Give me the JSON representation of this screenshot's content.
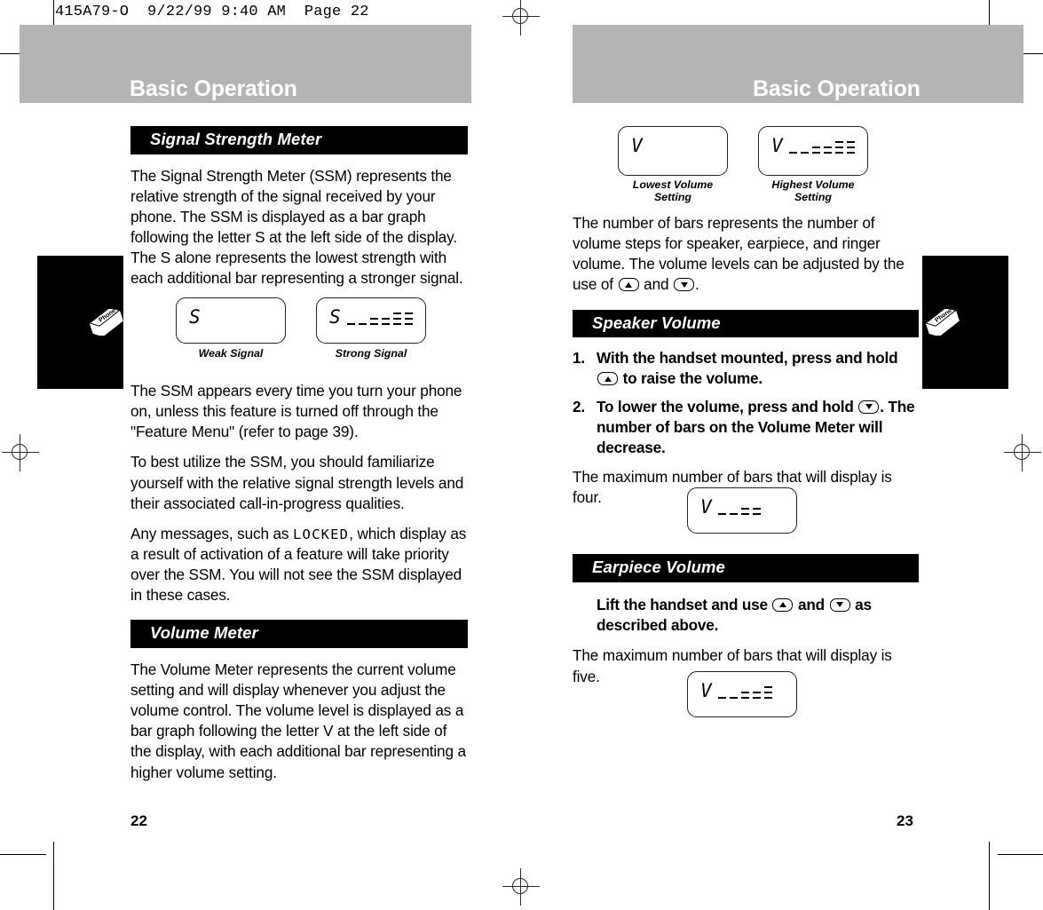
{
  "scan": {
    "header_line": "415A79-O  9/22/99 9:40 AM  Page 22"
  },
  "colors": {
    "banner_gray": "#b4b4b4",
    "section_head_bg": "#000000",
    "section_head_text": "#ffffff",
    "body_text": "#000000",
    "tab_black": "#000000"
  },
  "left_page": {
    "banner_title": "Basic Operation",
    "page_number": "22",
    "thumb_tab_icon": "phone-book-tab-icon",
    "sections": [
      {
        "heading": "Signal Strength Meter",
        "paragraphs": [
          "The Signal Strength Meter (SSM) represents the relative strength of the signal received by your phone. The SSM is displayed as a bar graph following the letter S at the left side of the display. The S alone represents the lowest strength with each additional bar representing a stronger signal."
        ]
      },
      {
        "heading": "Volume Meter",
        "paragraphs": [
          "The Volume Meter represents the current volume setting and will display whenever you adjust the volume control. The volume level is displayed as a bar graph following the letter V at the left side of the display, with each additional bar representing a higher volume setting."
        ]
      }
    ],
    "paragraphs_after_figure": [
      {
        "parts": [
          {
            "type": "text",
            "value": "The SSM appears every time you turn your phone on, unless this feature is turned off through the \"Feature Menu\" (refer to page 39)."
          }
        ]
      },
      {
        "parts": [
          {
            "type": "text",
            "value": "To best utilize the SSM, you should familiarize yourself with the relative signal strength levels and their associated call-in-progress qualities."
          }
        ]
      },
      {
        "parts": [
          {
            "type": "text",
            "value": "Any messages, such as "
          },
          {
            "type": "lcd",
            "value": "LOCKED"
          },
          {
            "type": "text",
            "value": ", which display as a result of activation of a feature will take priority over the SSM. You will not see the SSM displayed in these cases."
          }
        ]
      }
    ],
    "figures": [
      {
        "letter": "S",
        "bar_levels": [],
        "caption": "Weak Signal"
      },
      {
        "letter": "S",
        "bar_levels": [
          1,
          1,
          2,
          2,
          3,
          3
        ],
        "caption": "Strong Signal"
      }
    ]
  },
  "right_page": {
    "banner_title": "Basic Operation",
    "page_number": "23",
    "thumb_tab_icon": "phone-book-tab-icon",
    "figures_top": [
      {
        "letter": "V",
        "bar_levels": [],
        "caption": "Lowest Volume\nSetting"
      },
      {
        "letter": "V",
        "bar_levels": [
          1,
          1,
          2,
          2,
          3,
          3
        ],
        "caption": "Highest Volume\nSetting"
      }
    ],
    "intro_paragraph": {
      "parts": [
        {
          "type": "text",
          "value": "The number of bars represents the number of volume steps for speaker, earpiece, and ringer volume. The volume levels can be adjusted by the use of "
        },
        {
          "type": "key",
          "value": "up-arrow-key"
        },
        {
          "type": "text",
          "value": " and "
        },
        {
          "type": "key",
          "value": "down-arrow-key"
        },
        {
          "type": "text",
          "value": "."
        }
      ]
    },
    "speaker_section": {
      "heading": "Speaker Volume",
      "steps": [
        {
          "number": "1.",
          "parts": [
            {
              "type": "text",
              "value": "With the handset mounted, press and hold "
            },
            {
              "type": "key",
              "value": "up-arrow-key"
            },
            {
              "type": "text",
              "value": " to raise the volume."
            }
          ]
        },
        {
          "number": "2.",
          "parts": [
            {
              "type": "text",
              "value": "To lower the volume, press and hold "
            },
            {
              "type": "key",
              "value": "down-arrow-key"
            },
            {
              "type": "text",
              "value": ". The number of bars on the Volume Meter will decrease."
            }
          ]
        }
      ],
      "note": "The maximum number of bars that will display is four.",
      "figure": {
        "letter": "V",
        "bar_levels": [
          1,
          1,
          2,
          2
        ],
        "caption": ""
      }
    },
    "earpiece_section": {
      "heading": "Earpiece Volume",
      "instruction": {
        "parts": [
          {
            "type": "text",
            "value": "Lift the handset and use "
          },
          {
            "type": "key",
            "value": "up-arrow-key"
          },
          {
            "type": "text",
            "value": " and "
          },
          {
            "type": "key",
            "value": "down-arrow-key"
          },
          {
            "type": "text",
            "value": " as described above."
          }
        ]
      },
      "note": "The maximum number of bars that will display is five.",
      "figure": {
        "letter": "V",
        "bar_levels": [
          1,
          1,
          2,
          2,
          3
        ],
        "caption": ""
      }
    }
  }
}
